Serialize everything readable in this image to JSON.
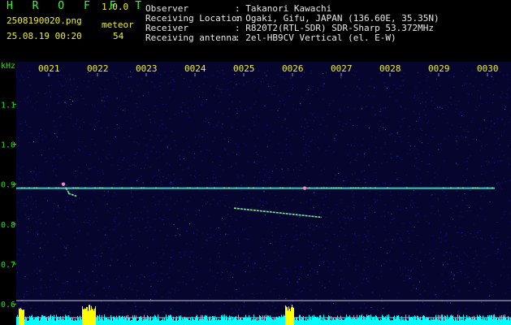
{
  "header": {
    "app_name": "H R O F F T",
    "version": "1.0.0",
    "filename": "2508190020.png",
    "datetime": "25.08.19 00:20",
    "count_label": "meteor",
    "count_value": "54",
    "info": [
      {
        "label": "Observer",
        "value": ": Takanori Kawachi"
      },
      {
        "label": "Receiving Location",
        "value": ": Ogaki, Gifu, JAPAN (136.60E, 35.35N)"
      },
      {
        "label": "Receiver",
        "value": ": R820T2(RTL-SDR) SDR-Sharp 53.372MHz"
      },
      {
        "label": "Receiving antenna",
        "value": ": 2el-HB9CV Vertical (el. E-W)"
      }
    ]
  },
  "colors": {
    "background": "#000000",
    "text": "#e8e8e8",
    "time_labels": "#f0f020",
    "freq_labels": "#20e020",
    "noise_bars": "#00ffff",
    "burst": "#ffff00"
  },
  "chart_data": {
    "type": "heatmap",
    "ylabel": "kHz",
    "time_ticks": [
      "0021",
      "0022",
      "0023",
      "0024",
      "0025",
      "0026",
      "0027",
      "0028",
      "0029",
      "0030"
    ],
    "freq_ticks": [
      {
        "label": "1.1",
        "value": 1.1
      },
      {
        "label": "1.0",
        "value": 1.0
      },
      {
        "label": "0.9",
        "value": 0.9
      },
      {
        "label": "0.8",
        "value": 0.8
      },
      {
        "label": "0.7",
        "value": 0.7
      },
      {
        "label": "0.6",
        "value": 0.6
      }
    ],
    "ylim": [
      0.58,
      1.18
    ],
    "carrier_khz": 0.89,
    "meteor_traces": [
      {
        "t_start": 0.35,
        "t_end": 0.42,
        "f_start": 0.89,
        "f_end": 0.877
      },
      {
        "t_start": 0.4,
        "t_end": 0.57,
        "f_start": 0.877,
        "f_end": 0.87
      },
      {
        "t_start": 3.8,
        "t_end": 5.6,
        "f_start": 0.84,
        "f_end": 0.817
      }
    ],
    "meteor_heads": [
      {
        "t": 0.3,
        "f": 0.9
      },
      {
        "t": 5.25,
        "f": 0.89
      }
    ]
  }
}
